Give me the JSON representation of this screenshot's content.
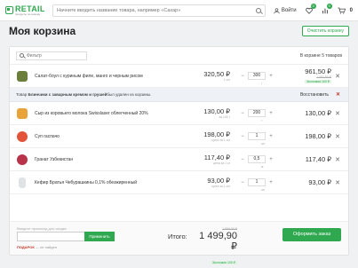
{
  "header": {
    "logo_name": "RETAIL",
    "logo_sub": "продукты по-новому",
    "search_placeholder": "Начните вводить название товара, например «Сахар»",
    "login_label": "Войти",
    "favorites_count": "0",
    "compare_count": "0",
    "cart_count": "0"
  },
  "page": {
    "title": "Моя корзина",
    "clear_button": "Очистить корзину"
  },
  "filter": {
    "placeholder": "Фильтр",
    "count_text": "В корзине 5 товаров"
  },
  "items": [
    {
      "name": "Салат-боул с куриным филе, манго и черным рисом",
      "price": "320,50 ₽",
      "price_sub": "1 шт",
      "qty": "300",
      "unit": "г",
      "total": "961,50 ₽",
      "old": "1 061,50 ₽",
      "disc": "Экономия 100 ₽",
      "color": "#6b7f3a"
    },
    {
      "name": "Сыр из коровьего молока Swisslaser облегченный 20%",
      "price": "130,00 ₽",
      "price_sub": "за 100 г",
      "qty": "200",
      "unit": "г",
      "total": "130,00 ₽",
      "color": "#e8a43a"
    },
    {
      "name": "Суп гаспачо",
      "price": "198,00 ₽",
      "price_sub": "цена за 1 шт",
      "qty": "1",
      "unit": "шт",
      "total": "198,00 ₽",
      "color": "#e2533a"
    },
    {
      "name": "Гранат Узбекистан",
      "price": "117,40 ₽",
      "price_sub": "цена за 1 кг",
      "qty": "0,5",
      "unit": "кг",
      "total": "117,40 ₽",
      "color": "#b8324a"
    },
    {
      "name": "Кефир Братья Чебурашкины 0,1% обезжиренный",
      "price": "93,00 ₽",
      "price_sub": "цена за 1 шт",
      "qty": "1",
      "unit": "шт",
      "total": "93,00 ₽",
      "color": "#dfe3e6"
    }
  ],
  "notice": {
    "prefix": "Товар ",
    "product": "Блинчики с заварным кремом и грушей",
    "suffix": " был удален из корзины.",
    "restore": "Восстановить"
  },
  "footer": {
    "promo_label": "Введите промокод для скидки",
    "promo_button": "Применить",
    "gift_key": "ПОДАРОК",
    "gift_value": "— не найден",
    "total_label": "Итого:",
    "total_old": "1 599,90 ₽",
    "total": "1 499,90 ₽",
    "total_disc": "Экономия 100 ₽",
    "order_button": "Оформить заказ"
  }
}
